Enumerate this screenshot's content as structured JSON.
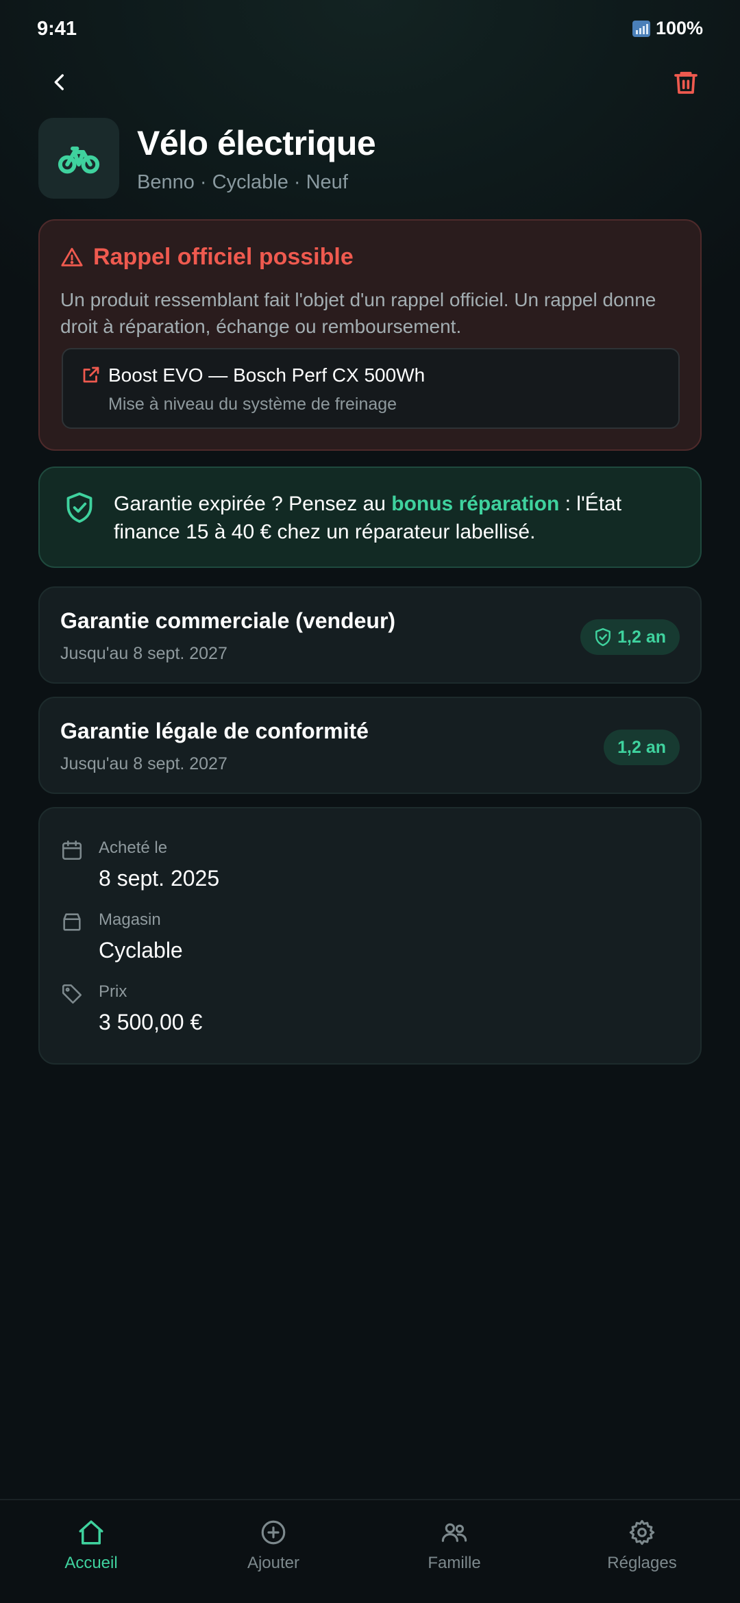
{
  "status_bar": {
    "time": "9:41",
    "battery": "100%"
  },
  "header": {
    "back_icon": "chevron-left-icon",
    "delete_icon": "trash-icon",
    "delete_color": "#ef5a4f"
  },
  "product": {
    "icon": "bicycle-icon",
    "title": "Vélo électrique",
    "subtitle": "Benno · Cyclable · Neuf"
  },
  "recall": {
    "title": "Rappel officiel possible",
    "body": "Un produit ressemblant fait l'objet d'un rappel officiel. Un rappel donne droit à réparation, échange ou remboursement.",
    "item_title": "Boost EVO — Bosch Perf CX 500Wh",
    "item_subtitle": "Mise à niveau du système de freinage",
    "accent_color": "#ef5a4f"
  },
  "bonus": {
    "text_before": "Garantie expirée ? Pensez au ",
    "highlight": "bonus réparation",
    "text_after": " : l'État finance 15 à 40 € chez un réparateur labellisé.",
    "accent_color": "#3fd29e"
  },
  "warranties": [
    {
      "title": "Garantie commerciale (vendeur)",
      "date": "Jusqu'au 8 sept. 2027",
      "badge": "1,2 an"
    },
    {
      "title": "Garantie légale de conformité",
      "date": "Jusqu'au 8 sept. 2027",
      "badge": "1,2 an"
    }
  ],
  "details": {
    "purchase_label": "Acheté le",
    "purchase_value": "8 sept. 2025",
    "store_label": "Magasin",
    "store_value": "Cyclable",
    "price_label": "Prix",
    "price_value": "3 500,00 €"
  },
  "nav": {
    "items": [
      {
        "label": "Accueil",
        "icon": "home-icon",
        "active": true
      },
      {
        "label": "Ajouter",
        "icon": "plus-circle-icon",
        "active": false
      },
      {
        "label": "Famille",
        "icon": "users-icon",
        "active": false
      },
      {
        "label": "Réglages",
        "icon": "gear-icon",
        "active": false
      }
    ]
  }
}
